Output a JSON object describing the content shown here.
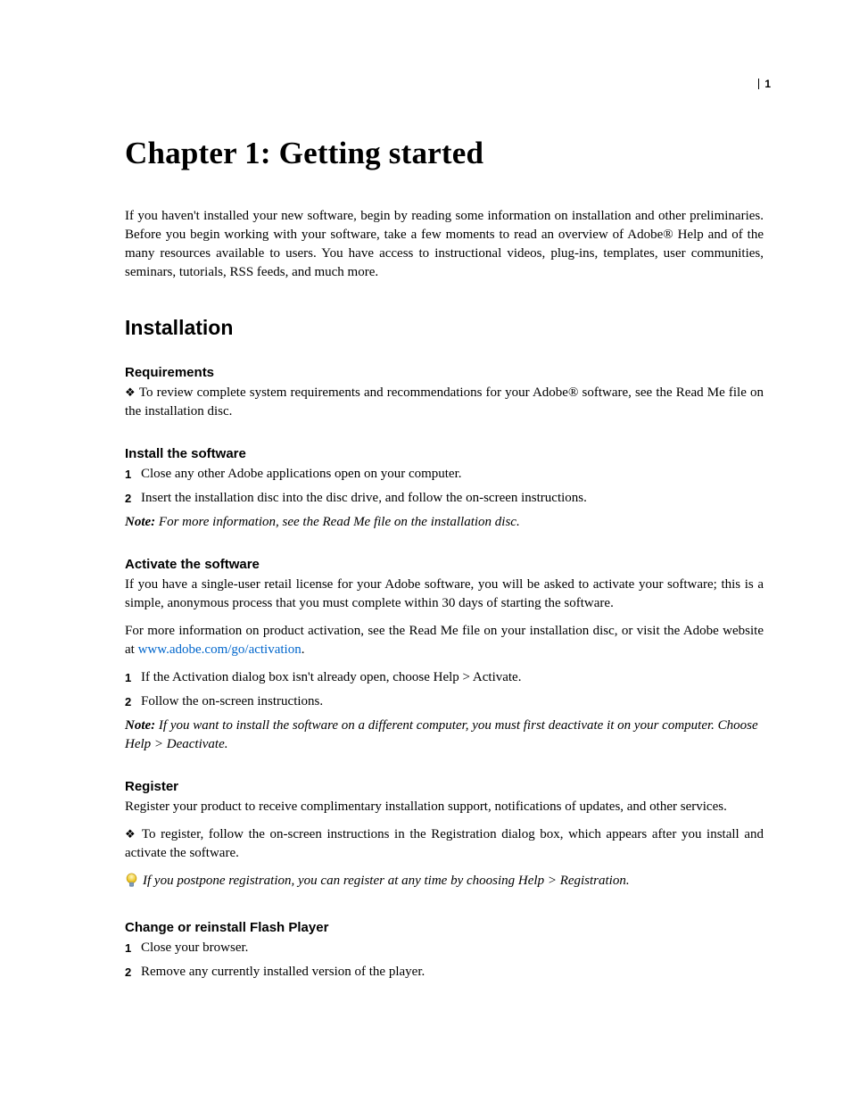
{
  "page_number": "1",
  "chapter_title": "Chapter 1: Getting started",
  "intro": "If you haven't installed your new software, begin by reading some information on installation and other preliminaries. Before you begin working with your software, take a few moments to read an overview of Adobe® Help and of the many resources available to users. You have access to instructional videos, plug-ins, templates, user communities, seminars, tutorials, RSS feeds, and much more.",
  "section_title": "Installation",
  "bullet_glyph": "❖",
  "requirements": {
    "heading": "Requirements",
    "body": "To review complete system requirements and recommendations for your Adobe® software, see the Read Me file on the installation disc."
  },
  "install": {
    "heading": "Install the software",
    "step1_num": "1",
    "step1": "Close any other Adobe applications open on your computer.",
    "step2_num": "2",
    "step2": "Insert the installation disc into the disc drive, and follow the on-screen instructions.",
    "note_label": "Note:",
    "note": " For more information, see the Read Me file on the installation disc."
  },
  "activate": {
    "heading": "Activate the software",
    "p1": "If you have a single-user retail license for your Adobe software, you will be asked to activate your software; this is a simple, anonymous process that you must complete within 30 days of starting the software.",
    "p2a": "For more information on product activation, see the Read Me file on your installation disc, or visit the Adobe website at ",
    "link_text": "www.adobe.com/go/activation",
    "link_href": "http://www.adobe.com/go/activation",
    "p2b": ".",
    "step1_num": "1",
    "step1": "If the Activation dialog box isn't already open, choose Help > Activate.",
    "step2_num": "2",
    "step2": "Follow the on-screen instructions.",
    "note_label": "Note:",
    "note": " If you want to install the software on a different computer, you must first deactivate it on your computer. Choose Help > Deactivate."
  },
  "register": {
    "heading": "Register",
    "p1": "Register your product to receive complimentary installation support, notifications of updates, and other services.",
    "bullet_body": "To register, follow the on-screen instructions in the Registration dialog box, which appears after you install and activate the software.",
    "tip": "If you postpone registration, you can register at any time by choosing Help > Registration."
  },
  "flash": {
    "heading": "Change or reinstall Flash Player",
    "step1_num": "1",
    "step1": "Close your browser.",
    "step2_num": "2",
    "step2": "Remove any currently installed version of the player."
  }
}
